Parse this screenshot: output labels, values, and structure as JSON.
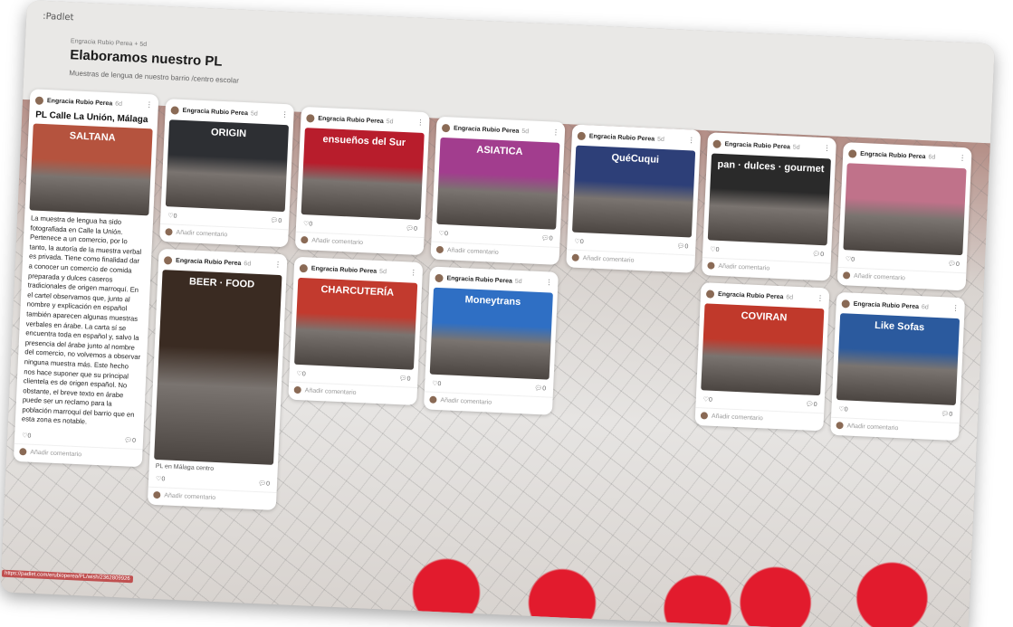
{
  "app": {
    "brand": ":Padlet",
    "meta": "Engracia Rubio Perea + 5d",
    "title": "Elaboramos nuestro PL",
    "subtitle": "Muestras de lengua de nuestro barrio /centro escolar",
    "status_url": "https://padlet.com/erubioperea/PL/wish/2362809926"
  },
  "common": {
    "author": "Engracia Rubio Perea",
    "add_comment": "Añadir comentario",
    "likes": "0",
    "comments": "0"
  },
  "columns": [
    {
      "cards": [
        {
          "age": "6d",
          "title": "PL Calle La Unión, Málaga",
          "sign": "SALTANA",
          "color": "#b5533e",
          "body": "La muestra de lengua ha sido fotografiada en Calle la Unión. Pertenece a un comercio, por lo tanto, la autoría de la muestra verbal es privada. Tiene como finalidad dar a conocer un comercio de comida preparada y dulces caseros tradicionales de origen marroquí. En el cartel observamos que, junto al nombre y explicación en español también aparecen algunas muestras verbales en árabe. La carta sí se encuentra toda en español y, salvo la presencia del árabe junto al nombre del comercio, no volvemos a observar ninguna muestra más. Este hecho nos hace suponer que su principal clientela es de origen español. No obstante, el breve texto en árabe puede ser un reclamo para la población marroquí del barrio que en esta zona es notable."
        }
      ]
    },
    {
      "cards": [
        {
          "age": "5d",
          "sign": "ORIGIN",
          "color": "#2d2f33"
        },
        {
          "age": "6d",
          "sign": "BEER · FOOD",
          "color": "#3a2b22",
          "caption": "PL en Málaga centro"
        }
      ]
    },
    {
      "cards": [
        {
          "age": "5d",
          "sign": "ensueños del Sur",
          "color": "#b81d2c"
        },
        {
          "age": "5d",
          "sign": "CHARCUTERÍA",
          "color": "#c23a2e"
        }
      ]
    },
    {
      "cards": [
        {
          "age": "5d",
          "sign": "ASIATICA",
          "color": "#a23d8e"
        },
        {
          "age": "5d",
          "sign": "Moneytrans",
          "color": "#2f6fc4"
        }
      ]
    },
    {
      "cards": [
        {
          "age": "5d",
          "sign": "QuéCuqui",
          "color": "#2d3f78"
        }
      ]
    },
    {
      "cards": [
        {
          "age": "5d",
          "sign": "pan · dulces · gourmet",
          "color": "#2a2a2a"
        },
        {
          "age": "6d",
          "sign": "COVIRAN",
          "color": "#c0392b"
        }
      ]
    },
    {
      "cards": [
        {
          "age": "6d",
          "sign": "",
          "color": "#c0728a"
        },
        {
          "age": "6d",
          "sign": "Like Sofas",
          "color": "#2b5a9e"
        }
      ]
    }
  ],
  "colors": {
    "accent": "#e21b2d",
    "card": "#ffffff",
    "header": "#e9e8e6"
  }
}
